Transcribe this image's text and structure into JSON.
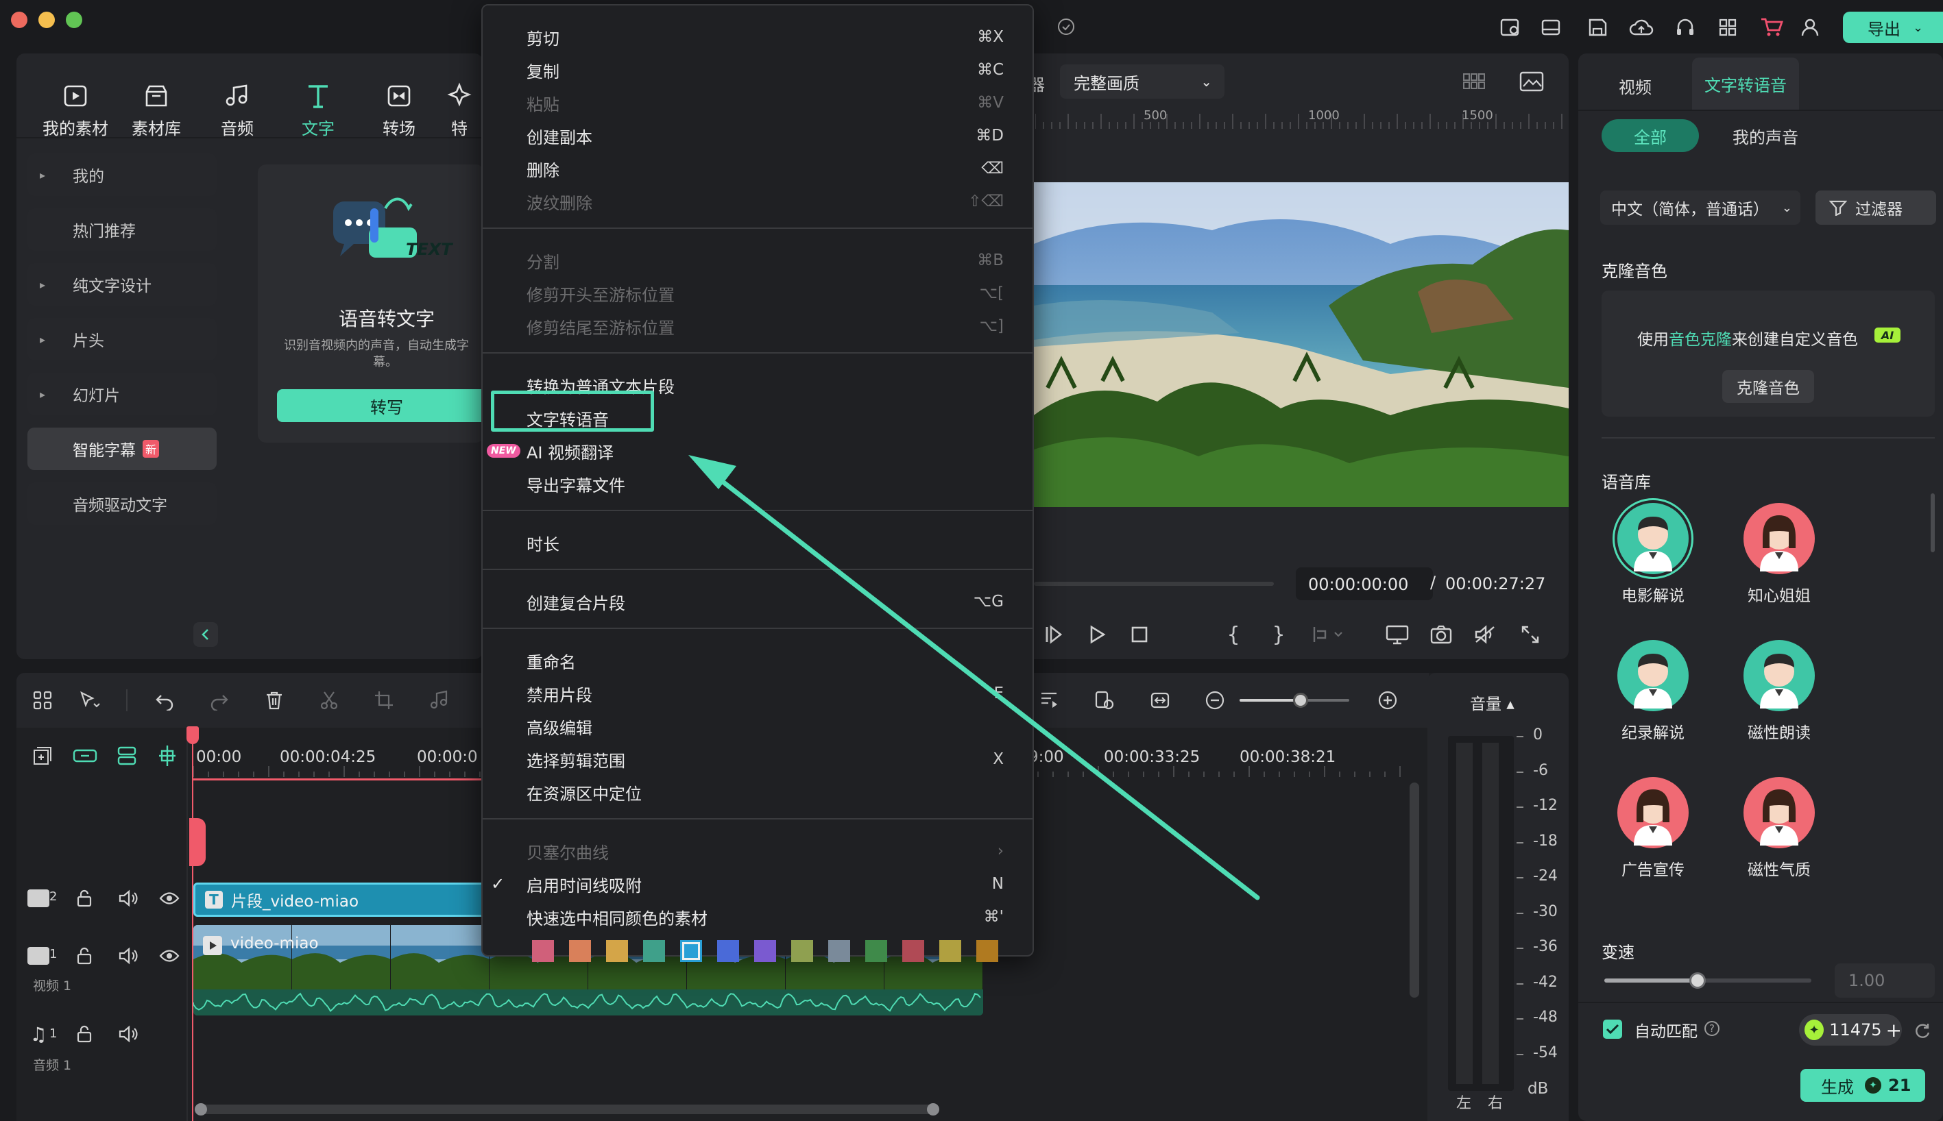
{
  "window": {
    "traffic": [
      "#ed6a5e",
      "#f5bf4f",
      "#61c454"
    ]
  },
  "toolbar": {
    "tabs": [
      {
        "label": "我的素材",
        "icon": "my-media-icon"
      },
      {
        "label": "素材库",
        "icon": "stock-media-icon"
      },
      {
        "label": "音频",
        "icon": "audio-icon"
      },
      {
        "label": "文字",
        "icon": "text-icon",
        "active": true
      },
      {
        "label": "转场",
        "icon": "transition-icon"
      },
      {
        "label": "特",
        "icon": "effects-icon"
      }
    ]
  },
  "header": {
    "export_label": "导出"
  },
  "sidebar": {
    "items": [
      {
        "label": "我的",
        "arrow": true
      },
      {
        "label": "热门推荐",
        "arrow": false
      },
      {
        "label": "纯文字设计",
        "arrow": true
      },
      {
        "label": "片头",
        "arrow": true
      },
      {
        "label": "幻灯片",
        "arrow": true
      },
      {
        "label": "智能字幕",
        "badge": "新",
        "active": true
      },
      {
        "label": "音频驱动文字",
        "arrow": false
      }
    ]
  },
  "feature_card": {
    "badge_text": "TEXT",
    "title": "语音转文字",
    "desc_line1": "识别音视频内的声音，自动生成字",
    "desc_line2": "幕。",
    "button": "转写"
  },
  "preview": {
    "partial_label": "器",
    "quality": "完整画质",
    "ruler_ticks": [
      "500",
      "1000",
      "1500"
    ],
    "current_time": "00:00:00:00",
    "separator": "/",
    "total_time": "00:00:27:27"
  },
  "context_menu": {
    "groups": [
      [
        {
          "label": "剪切",
          "shortcut": "⌘X"
        },
        {
          "label": "复制",
          "shortcut": "⌘C"
        },
        {
          "label": "粘贴",
          "shortcut": "⌘V",
          "disabled": true
        },
        {
          "label": "创建副本",
          "shortcut": "⌘D"
        },
        {
          "label": "删除",
          "shortcut": "⌫"
        },
        {
          "label": "波纹删除",
          "shortcut": "⇧⌫",
          "disabled": true
        }
      ],
      [
        {
          "label": "分割",
          "shortcut": "⌘B",
          "disabled": true
        },
        {
          "label": "修剪开头至游标位置",
          "shortcut": "⌥[",
          "disabled": true
        },
        {
          "label": "修剪结尾至游标位置",
          "shortcut": "⌥]",
          "disabled": true
        }
      ],
      [
        {
          "label": "转换为普通文本片段",
          "shortcut": ""
        },
        {
          "label": "文字转语音",
          "shortcut": "",
          "highlight": true
        },
        {
          "label": "AI 视频翻译",
          "shortcut": "",
          "badge": "NEW"
        },
        {
          "label": "导出字幕文件",
          "shortcut": ""
        }
      ],
      [
        {
          "label": "时长",
          "shortcut": ""
        }
      ],
      [
        {
          "label": "创建复合片段",
          "shortcut": "⌥G"
        }
      ],
      [
        {
          "label": "重命名",
          "shortcut": ""
        },
        {
          "label": "禁用片段",
          "shortcut": "E"
        },
        {
          "label": "高级编辑",
          "shortcut": ""
        },
        {
          "label": "选择剪辑范围",
          "shortcut": "X"
        },
        {
          "label": "在资源区中定位",
          "shortcut": ""
        }
      ],
      [
        {
          "label": "贝塞尔曲线",
          "shortcut": "›",
          "disabled": true
        },
        {
          "label": "启用时间线吸附",
          "shortcut": "N",
          "checked": true
        },
        {
          "label": "快速选中相同颜色的素材",
          "shortcut": "⌘'"
        }
      ]
    ],
    "swatches": [
      "#d0607a",
      "#d9805a",
      "#d4a548",
      "#3fa08a",
      "#2a9fd6",
      "#4a6ad8",
      "#7a5ad0",
      "#8fa050",
      "#7a8a9a",
      "#3f8a4a",
      "#b04a55",
      "#b0a040",
      "#b07a20"
    ],
    "selected_swatch": 4
  },
  "timeline": {
    "ruler": [
      "00:00",
      "00:00:04:25",
      "00:00:0",
      "9:00",
      "00:00:33:25",
      "00:00:38:21"
    ],
    "tracks": [
      {
        "num": "2",
        "name": ""
      },
      {
        "num": "1",
        "name": "视频 1"
      },
      {
        "num": "1",
        "name": "音频 1"
      }
    ],
    "text_clip": "片段_video-miao",
    "video_clip": "video-miao",
    "volume_title": "音量 ▴",
    "db_scale": [
      "0",
      "-6",
      "-12",
      "-18",
      "-24",
      "-30",
      "-36",
      "-42",
      "-48",
      "-54"
    ],
    "db_unit": "dB",
    "lr": [
      "左",
      "右"
    ]
  },
  "right_panel": {
    "tabs": [
      "视频",
      "文字转语音"
    ],
    "subtabs": [
      "全部",
      "我的声音"
    ],
    "language": "中文（简体，普通话）",
    "filter": "过滤器",
    "clone_title": "克隆音色",
    "clone_text_pre": "使用",
    "clone_text_link": "音色克隆",
    "clone_text_post": "来创建自定义音色",
    "clone_ai": "AI",
    "clone_button": "克隆音色",
    "library_title": "语音库",
    "voices": [
      {
        "label": "电影解说",
        "bg": "#3fc6a6",
        "gender": "m",
        "selected": true
      },
      {
        "label": "知心姐姐",
        "bg": "#f06a74",
        "gender": "f"
      },
      {
        "label": "纪录解说",
        "bg": "#3fc6a6",
        "gender": "m"
      },
      {
        "label": "磁性朗读",
        "bg": "#3fc6a6",
        "gender": "m"
      },
      {
        "label": "广告宣传",
        "bg": "#f06a74",
        "gender": "f"
      },
      {
        "label": "磁性气质",
        "bg": "#f06a74",
        "gender": "f"
      }
    ],
    "speed_title": "变速",
    "speed_value": "1.00",
    "speed_level": 0.45,
    "auto_match": "自动匹配",
    "credits": "11475",
    "generate": "生成",
    "generate_cost": "21"
  },
  "colors": {
    "accent": "#4fdcb4",
    "accent_dark": "#2aa98a",
    "menu_bg": "#1f2023"
  }
}
